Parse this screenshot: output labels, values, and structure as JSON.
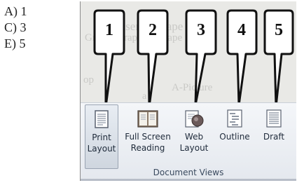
{
  "options": [
    "A) 1",
    "C) 3",
    "E) 5"
  ],
  "background_text": {
    "line1": "Insert a Shape from",
    "line2": "Graph, Graph or Shape",
    "line3": "A-Picture",
    "line4": "a",
    "line5": "6. 5",
    "line6": "op"
  },
  "callouts": [
    "1",
    "2",
    "3",
    "4",
    "5"
  ],
  "ribbon": {
    "buttons": [
      {
        "line1": "Print",
        "line2": "Layout",
        "icon": "print-layout-icon",
        "active": true
      },
      {
        "line1": "Full Screen",
        "line2": "Reading",
        "icon": "full-screen-reading-icon",
        "active": false
      },
      {
        "line1": "Web",
        "line2": "Layout",
        "icon": "web-layout-icon",
        "active": false
      },
      {
        "line1": "Outline",
        "line2": "",
        "icon": "outline-icon",
        "active": false
      },
      {
        "line1": "Draft",
        "line2": "",
        "icon": "draft-icon",
        "active": false
      }
    ],
    "group_label": "Document Views"
  }
}
